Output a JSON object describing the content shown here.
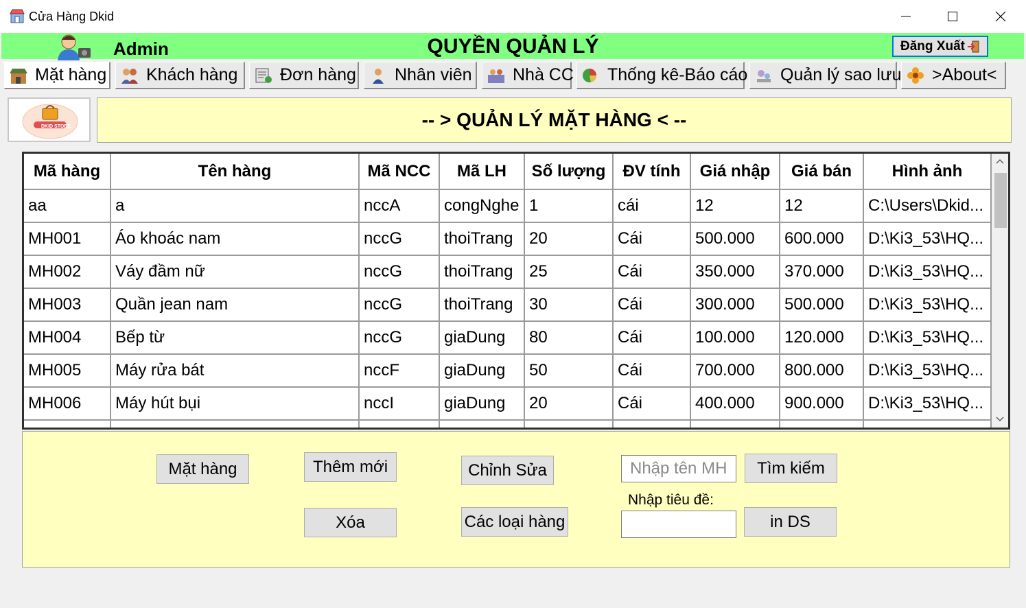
{
  "window": {
    "title": "Cửa Hàng Dkid",
    "minimize": "—",
    "maximize": "☐",
    "close": "✕"
  },
  "header": {
    "user": "Admin",
    "role_title": "QUYỀN QUẢN LÝ",
    "logout_label": "Đăng Xuất"
  },
  "tabs": [
    {
      "label": "Mặt hàng",
      "icon": "shop-icon"
    },
    {
      "label": "Khách hàng",
      "icon": "customers-icon"
    },
    {
      "label": "Đơn hàng",
      "icon": "orders-icon"
    },
    {
      "label": "Nhân viên",
      "icon": "employee-icon"
    },
    {
      "label": "Nhà CC",
      "icon": "supplier-icon"
    },
    {
      "label": "Thống kê-Báo cáo",
      "icon": "report-icon"
    },
    {
      "label": "Quản lý sao lưu",
      "icon": "backup-icon"
    },
    {
      "label": ">About<",
      "icon": "flower-icon"
    }
  ],
  "logo": {
    "text": "DKID STORE"
  },
  "banner": {
    "title": "-- > QUẢN LÝ MẶT HÀNG < --"
  },
  "grid": {
    "columns": [
      "Mã hàng",
      "Tên hàng",
      "Mã NCC",
      "Mã LH",
      "Số lượng",
      "ĐV tính",
      "Giá nhập",
      "Giá bán",
      "Hình ảnh"
    ],
    "rows": [
      [
        "aa",
        "a",
        "nccA",
        "congNghe",
        "1",
        "cái",
        "12",
        "12",
        "C:\\Users\\Dkid..."
      ],
      [
        "MH001",
        "Áo khoác nam",
        "nccG",
        "thoiTrang",
        "20",
        "Cái",
        "500.000",
        "600.000",
        "D:\\Ki3_53\\HQ..."
      ],
      [
        "MH002",
        "Váy đầm nữ",
        "nccG",
        "thoiTrang",
        "25",
        "Cái",
        "350.000",
        "370.000",
        "D:\\Ki3_53\\HQ..."
      ],
      [
        "MH003",
        "Quần jean nam",
        "nccG",
        "thoiTrang",
        "30",
        "Cái",
        "300.000",
        "500.000",
        "D:\\Ki3_53\\HQ..."
      ],
      [
        "MH004",
        "Bếp từ",
        "nccG",
        "giaDung",
        "80",
        "Cái",
        "100.000",
        "120.000",
        "D:\\Ki3_53\\HQ..."
      ],
      [
        "MH005",
        "Máy rửa bát",
        "nccF",
        "giaDung",
        "50",
        "Cái",
        "700.000",
        "800.000",
        "D:\\Ki3_53\\HQ..."
      ],
      [
        "MH006",
        "Máy hút bụi",
        "nccI",
        "giaDung",
        "20",
        "Cái",
        "400.000",
        "900.000",
        "D:\\Ki3_53\\HQ..."
      ]
    ]
  },
  "actions": {
    "mathang": "Mặt hàng",
    "themmoi": "Thêm mới",
    "chinhsua": "Chỉnh Sửa",
    "timkiem": "Tìm kiếm",
    "xoa": "Xóa",
    "cacloaihang": "Các loại hàng",
    "inds": "in DS",
    "search_placeholder": "Nhập tên MH",
    "search_value": "",
    "title_label": "Nhập tiêu đề:",
    "title_value": ""
  },
  "colors": {
    "header_bg": "#80ff80",
    "panel_bg": "#ffffc0",
    "logout_border": "#0078d7"
  }
}
